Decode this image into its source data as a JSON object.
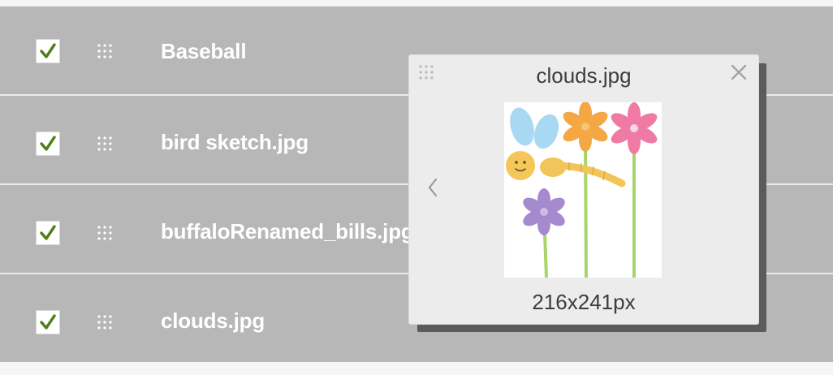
{
  "files": [
    {
      "name": "Baseball",
      "checked": true
    },
    {
      "name": "bird sketch.jpg",
      "checked": true
    },
    {
      "name": "buffaloRenamed_bills.jpg",
      "checked": true
    },
    {
      "name": "clouds.jpg",
      "checked": true
    }
  ],
  "preview": {
    "title": "clouds.jpg",
    "dimensions": "216x241px",
    "image_icon": "flowers-dragonfly-image",
    "close_icon": "close-icon",
    "prev_icon": "chevron-left-icon"
  },
  "colors": {
    "row_background": "#b7b7b7",
    "row_divider": "#ececec",
    "check_color": "#4f7f1a",
    "popup_background": "#ececec",
    "label_color": "#ffffff"
  }
}
